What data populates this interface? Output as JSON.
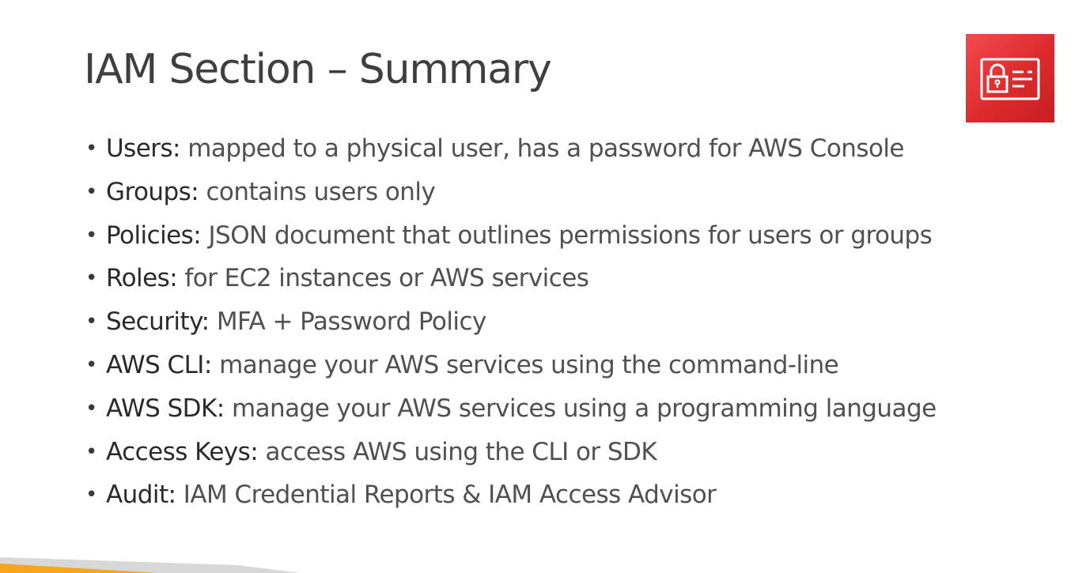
{
  "slide": {
    "title": "IAM Section – Summary",
    "icon": "iam-identity-icon",
    "accent_color": "#dd2a2c",
    "footer_colors": [
      "#f7a51b",
      "#d8d8d8"
    ]
  },
  "bullets": [
    {
      "term": "Users:",
      "text": "mapped to a physical user, has a password for AWS Console"
    },
    {
      "term": "Groups:",
      "text": "contains users only"
    },
    {
      "term": "Policies:",
      "text": "JSON document that outlines permissions for users or groups"
    },
    {
      "term": "Roles:",
      "text": "for EC2 instances or AWS services"
    },
    {
      "term": "Security:",
      "text": "MFA + Password Policy"
    },
    {
      "term": "AWS CLI:",
      "text": "manage your AWS services using the command-line"
    },
    {
      "term": "AWS SDK:",
      "text": "manage your AWS services using a programming language"
    },
    {
      "term": "Access Keys:",
      "text": "access AWS using the CLI or SDK"
    },
    {
      "term": "Audit:",
      "text": "IAM Credential Reports & IAM Access Advisor"
    }
  ]
}
